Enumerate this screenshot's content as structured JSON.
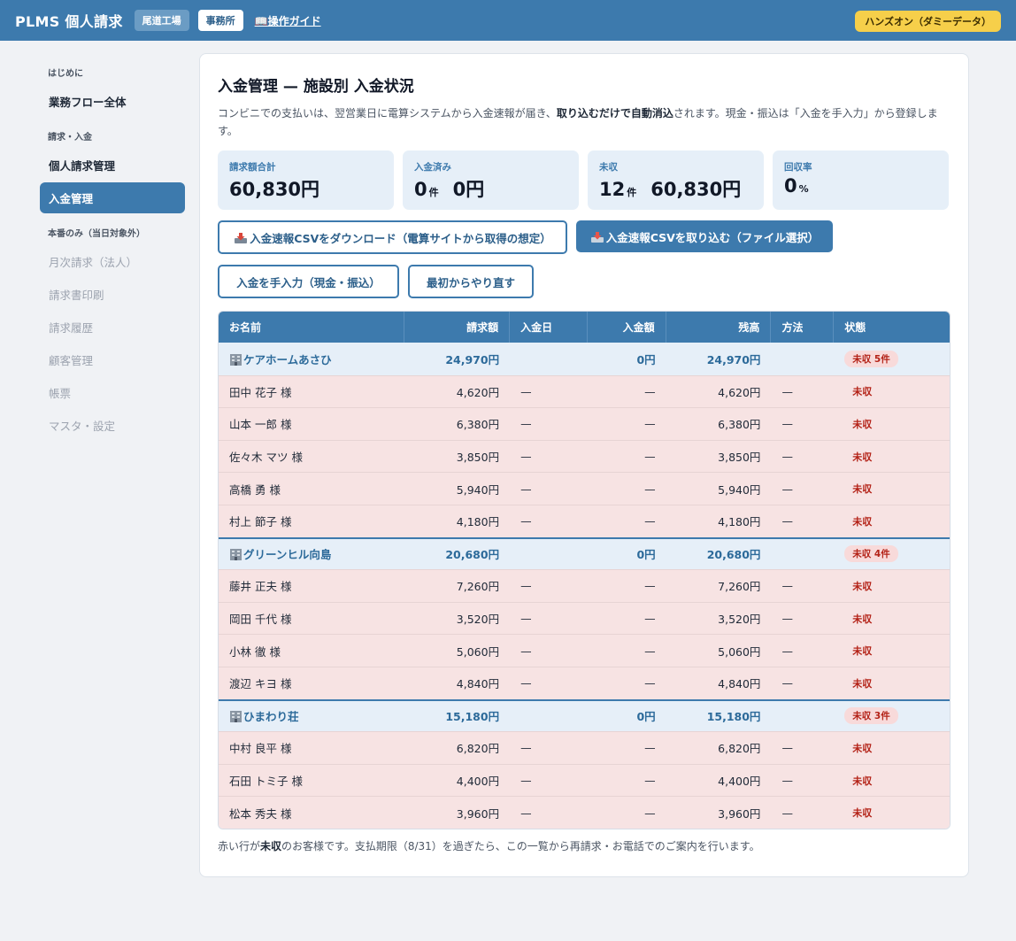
{
  "header": {
    "app_title": "PLMS 個人請求",
    "site_chip": "尾道工場",
    "office_chip": "事務所",
    "guide_label": "操作ガイド",
    "demo_badge": "ハンズオン（ダミーデータ）"
  },
  "sidebar": {
    "sections": [
      {
        "heading": "はじめに",
        "items": [
          {
            "label": "業務フロー全体",
            "state": "normal"
          }
        ]
      },
      {
        "heading": "請求・入金",
        "items": [
          {
            "label": "個人請求管理",
            "state": "normal"
          },
          {
            "label": "入金管理",
            "state": "active"
          }
        ]
      },
      {
        "heading": "本番のみ（当日対象外）",
        "items": [
          {
            "label": "月次請求（法人）",
            "state": "disabled"
          },
          {
            "label": "請求書印刷",
            "state": "disabled"
          },
          {
            "label": "請求履歴",
            "state": "disabled"
          },
          {
            "label": "顧客管理",
            "state": "disabled"
          },
          {
            "label": "帳票",
            "state": "disabled"
          },
          {
            "label": "マスタ・設定",
            "state": "disabled"
          }
        ]
      }
    ]
  },
  "page": {
    "title": "入金管理 — 施設別 入金状況",
    "desc_1": "コンビニでの支払いは、翌営業日に電算システムから入金速報が届き、",
    "desc_bold": "取り込むだけで自動消込",
    "desc_2": "されます。現金・振込は「入金を手入力」から登録します。"
  },
  "summary": {
    "billed_label": "請求額合計",
    "billed_value": "60,830円",
    "paid_label": "入金済み",
    "paid_count": "0",
    "paid_count_unit": "件",
    "paid_amount": "0円",
    "unpaid_label": "未収",
    "unpaid_count": "12",
    "unpaid_count_unit": "件",
    "unpaid_amount": "60,830円",
    "rate_label": "回収率",
    "rate_value": "0",
    "rate_unit": "%"
  },
  "actions": {
    "download_csv": "入金速報CSVをダウンロード（電算サイトから取得の想定）",
    "import_csv": "入金速報CSVを取り込む（ファイル選択）",
    "manual_entry": "入金を手入力（現金・振込）",
    "reset": "最初からやり直す"
  },
  "table": {
    "columns": [
      "お名前",
      "請求額",
      "入金日",
      "入金額",
      "残高",
      "方法",
      "状態"
    ],
    "groups": [
      {
        "facility": "ケアホームあさひ",
        "billed": "24,970円",
        "paid": "0円",
        "balance": "24,970円",
        "status": "未収 5件",
        "rows": [
          {
            "name": "田中 花子 様",
            "billed": "4,620円",
            "date": "—",
            "paid": "—",
            "balance": "4,620円",
            "method": "—",
            "status": "未収"
          },
          {
            "name": "山本 一郎 様",
            "billed": "6,380円",
            "date": "—",
            "paid": "—",
            "balance": "6,380円",
            "method": "—",
            "status": "未収"
          },
          {
            "name": "佐々木 マツ 様",
            "billed": "3,850円",
            "date": "—",
            "paid": "—",
            "balance": "3,850円",
            "method": "—",
            "status": "未収"
          },
          {
            "name": "高橋 勇 様",
            "billed": "5,940円",
            "date": "—",
            "paid": "—",
            "balance": "5,940円",
            "method": "—",
            "status": "未収"
          },
          {
            "name": "村上 節子 様",
            "billed": "4,180円",
            "date": "—",
            "paid": "—",
            "balance": "4,180円",
            "method": "—",
            "status": "未収"
          }
        ]
      },
      {
        "facility": "グリーンヒル向島",
        "billed": "20,680円",
        "paid": "0円",
        "balance": "20,680円",
        "status": "未収 4件",
        "rows": [
          {
            "name": "藤井 正夫 様",
            "billed": "7,260円",
            "date": "—",
            "paid": "—",
            "balance": "7,260円",
            "method": "—",
            "status": "未収"
          },
          {
            "name": "岡田 千代 様",
            "billed": "3,520円",
            "date": "—",
            "paid": "—",
            "balance": "3,520円",
            "method": "—",
            "status": "未収"
          },
          {
            "name": "小林 徹 様",
            "billed": "5,060円",
            "date": "—",
            "paid": "—",
            "balance": "5,060円",
            "method": "—",
            "status": "未収"
          },
          {
            "name": "渡辺 キヨ 様",
            "billed": "4,840円",
            "date": "—",
            "paid": "—",
            "balance": "4,840円",
            "method": "—",
            "status": "未収"
          }
        ]
      },
      {
        "facility": "ひまわり荘",
        "billed": "15,180円",
        "paid": "0円",
        "balance": "15,180円",
        "status": "未収 3件",
        "rows": [
          {
            "name": "中村 良平 様",
            "billed": "6,820円",
            "date": "—",
            "paid": "—",
            "balance": "6,820円",
            "method": "—",
            "status": "未収"
          },
          {
            "name": "石田 トミ子 様",
            "billed": "4,400円",
            "date": "—",
            "paid": "—",
            "balance": "4,400円",
            "method": "—",
            "status": "未収"
          },
          {
            "name": "松本 秀夫 様",
            "billed": "3,960円",
            "date": "—",
            "paid": "—",
            "balance": "3,960円",
            "method": "—",
            "status": "未収"
          }
        ]
      }
    ]
  },
  "footnote": {
    "part_1": "赤い行が",
    "part_bold": "未収",
    "part_2": "のお客様です。支払期限（8/31）を過ぎたら、この一覧から再請求・お電話でのご案内を行います。"
  },
  "colors": {
    "primary": "#3d7aad",
    "unpaid_row": "#f7e3e3",
    "unpaid_text": "#b42318",
    "card_bg": "#e6eff8",
    "demo_badge": "#f6cf4a"
  }
}
